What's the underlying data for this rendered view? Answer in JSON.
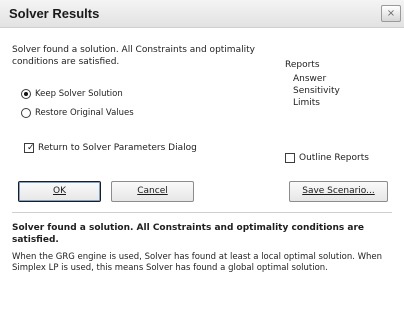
{
  "window": {
    "title": "Solver Results",
    "close_glyph": "×"
  },
  "main": {
    "message_line1": "Solver found a solution.  All Constraints and optimality",
    "message_line2": "conditions are satisfied."
  },
  "reports": {
    "title": "Reports",
    "items": [
      "Answer",
      "Sensitivity",
      "Limits"
    ]
  },
  "options": {
    "keep_label": "Keep Solver Solution",
    "keep_selected": true,
    "restore_label": "Restore Original Values",
    "restore_selected": false
  },
  "checks": {
    "return_label": "Return to Solver Parameters Dialog",
    "return_checked": true,
    "outline_label": "Outline Reports",
    "outline_checked": false
  },
  "buttons": {
    "ok": "OK",
    "cancel": "Cancel",
    "save_scenario": "Save Scenario..."
  },
  "info": {
    "bold_text": "Solver found a solution.  All Constraints and optimality conditions are satisfied.",
    "detail_text": "When the GRG engine is used, Solver has found at least a local optimal solution. When Simplex LP is used, this means Solver has found a global optimal solution."
  }
}
